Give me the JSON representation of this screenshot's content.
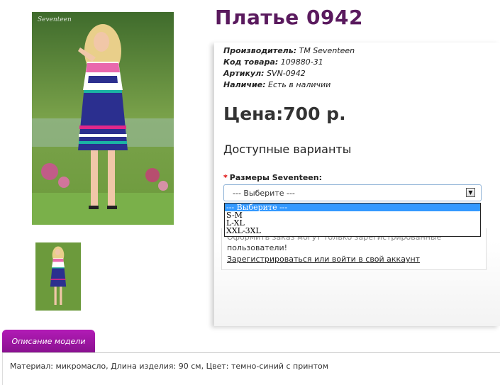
{
  "product": {
    "title": "Платье 0942",
    "watermark": "Seventeen",
    "manufacturer_label": "Производитель:",
    "manufacturer": "TM Seventeen",
    "code_label": "Код товара:",
    "code": "109880-31",
    "article_label": "Артикул:",
    "article": "SVN-0942",
    "availability_label": "Наличие:",
    "availability": "Есть в наличии",
    "price": "Цена:700 р."
  },
  "options": {
    "heading": "Доступные варианты",
    "required_mark": "*",
    "size_label": "Размеры Seventeen:",
    "selected": "--- Выберите ---",
    "list": [
      "--- Выберите ---",
      "S-M",
      "L-XL",
      "XXL-3XL"
    ]
  },
  "login": {
    "notice_top": "Оформить заказ могут только зарегистрированные",
    "notice": "пользователи!",
    "link": "Зарегистрироваться или войти в свой аккаунт"
  },
  "description": {
    "tab_label": "Описание модели",
    "text": "Материал: микромасло, Длина изделия: 90 см, Цвет: темно-синий с принтом"
  },
  "colors": {
    "title": "#5a1a5e",
    "tab": "#9b16a0",
    "dress": "#2b2f8f",
    "selected_option": "#3399ff"
  }
}
